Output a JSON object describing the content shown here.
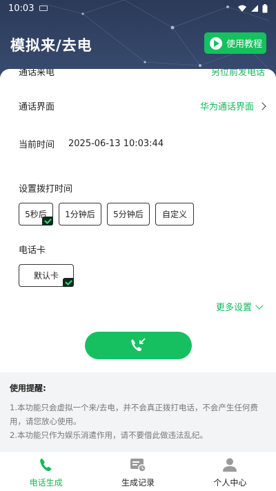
{
  "status": {
    "time": "10:03"
  },
  "header": {
    "title": "模拟来/去电",
    "tutorial_label": "使用教程"
  },
  "rows": {
    "partial_label": "通话来电",
    "partial_value": "另位前发电话",
    "ui_label": "通话界面",
    "ui_value": "华为通话界面",
    "time_label": "当前时间",
    "time_value": "2025-06-13 10:03:44"
  },
  "dial_time": {
    "label": "设置拨打时间",
    "options": [
      "5秒后",
      "1分钟后",
      "5分钟后",
      "自定义"
    ],
    "selected": "5秒后"
  },
  "sim": {
    "label": "电话卡",
    "option": "默认卡"
  },
  "more_settings": "更多设置",
  "tips": {
    "title": "使用提醒:",
    "line1": "1.本功能只会虚拟一个来/去电，并不会真正拨打电话，不会产生任何费用，请您放心使用。",
    "line2": "2.本功能只作为娱乐消遣作用，请不要借此做违法乱纪。"
  },
  "tabs": [
    "电话生成",
    "生成记录",
    "个人中心"
  ],
  "colors": {
    "accent": "#16c060",
    "header_bg": "#2e3f5e"
  }
}
